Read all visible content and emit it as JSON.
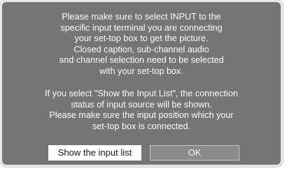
{
  "dialog": {
    "message_1": [
      "Please make sure to select INPUT to the",
      "specific input terminal you are connecting",
      "your set-top box to get the picture.",
      "Closed caption, sub-channel audio",
      "and channel selection need to be selected",
      "with your set-top box."
    ],
    "message_2": [
      "If you select \"Show the Input List\", the connection",
      "status of input source will be shown.",
      "Please make sure the input position which your",
      "set-top box is connected."
    ],
    "buttons": {
      "show_input_list_label": "Show the input list",
      "ok_label": "OK"
    }
  },
  "colors": {
    "dialog_background": "#757575",
    "dialog_border": "#e8e8e8",
    "text": "#ffffff",
    "focused_button_background": "#ffffff",
    "focused_button_text": "#1a1a1a",
    "ok_button_background": "#8a8a8a",
    "ok_button_border": "#c9c9c9"
  }
}
